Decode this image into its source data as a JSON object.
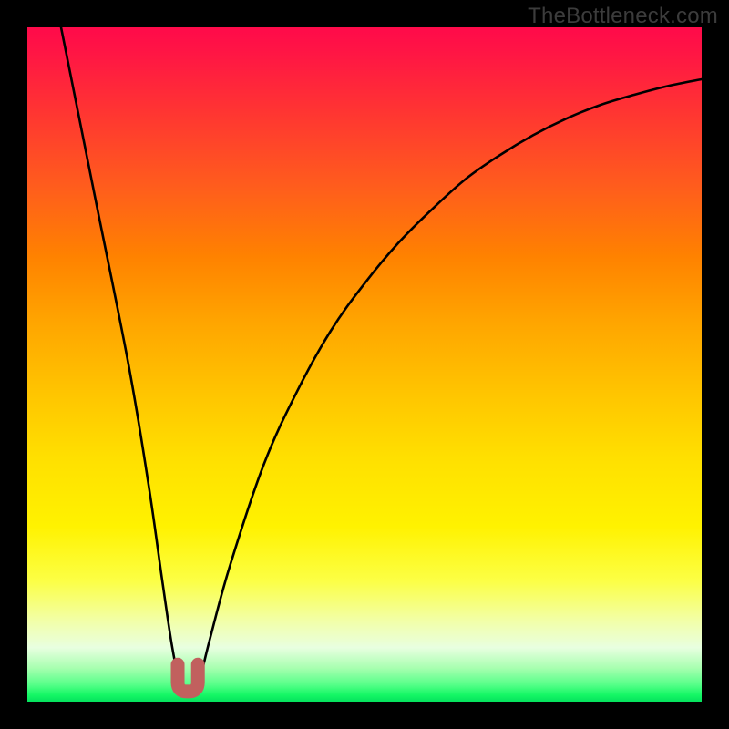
{
  "watermark": "TheBottleneck.com",
  "chart_data": {
    "type": "line",
    "title": "",
    "xlabel": "",
    "ylabel": "",
    "xlim": [
      0,
      100
    ],
    "ylim": [
      0,
      100
    ],
    "series": [
      {
        "name": "bottleneck-curve",
        "x": [
          5,
          10,
          15,
          18,
          20,
          21.5,
          22.8,
          24,
          25.2,
          27,
          30,
          35,
          40,
          45,
          50,
          55,
          60,
          65,
          70,
          75,
          80,
          85,
          90,
          95,
          100
        ],
        "values": [
          100,
          75,
          50,
          32,
          18,
          8,
          2,
          1,
          2,
          9,
          20,
          35,
          46,
          55,
          62,
          68,
          73,
          77.5,
          81,
          84,
          86.5,
          88.5,
          90,
          91.3,
          92.3
        ]
      }
    ],
    "annotations": [
      {
        "name": "local-minimum-marker",
        "shape": "u",
        "color": "#c1605e",
        "x": 23.8,
        "y": 1.5,
        "width": 3.0,
        "height": 4.0
      }
    ]
  }
}
